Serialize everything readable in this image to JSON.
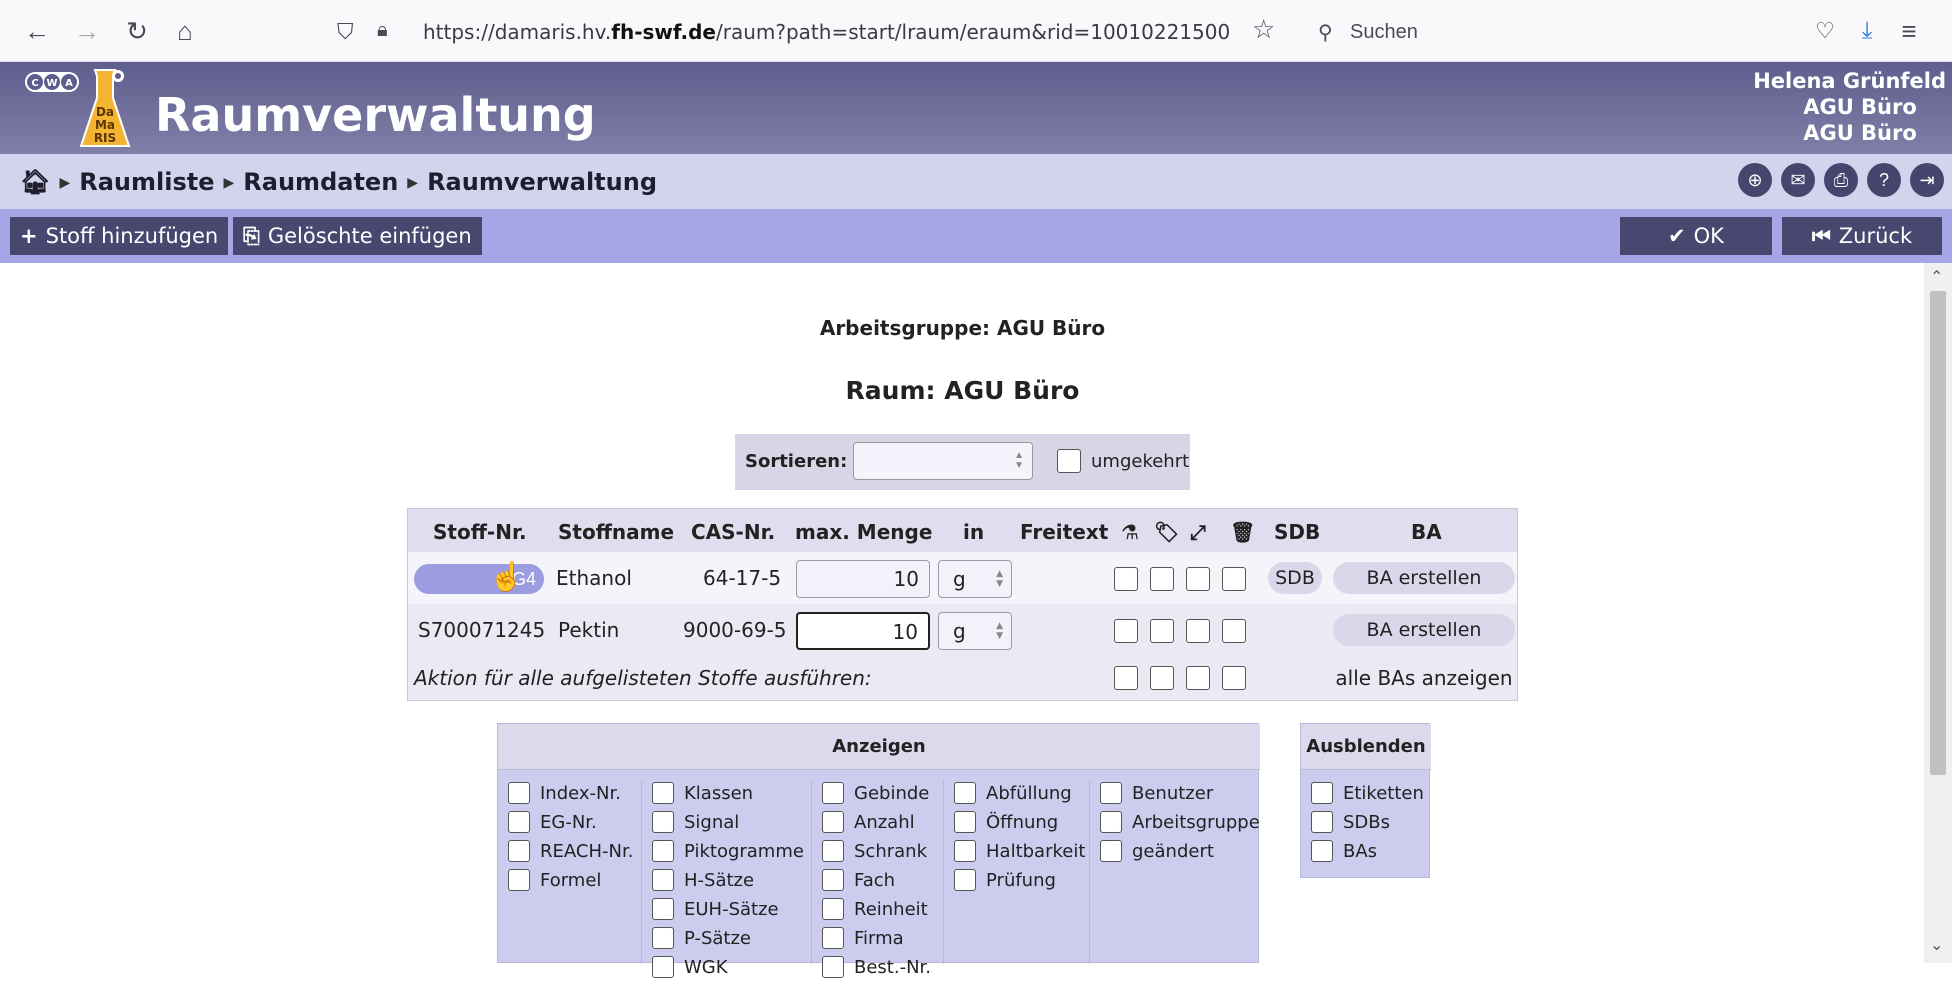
{
  "browser": {
    "url_prefix": "https://damaris.hv.",
    "url_domain": "fh-swf.de",
    "url_path": "/raum?path=start/lraum/eraum&rid=10010221500",
    "search_placeholder": "Suchen"
  },
  "header": {
    "app_title": "Raumverwaltung",
    "logo_cwa": "CWA",
    "logo_da": "Da",
    "logo_ma": "Ma",
    "logo_ris": "RIS",
    "user_name": "Helena Grünfeld",
    "user_group": "AGU Büro",
    "user_room": "AGU Büro"
  },
  "breadcrumb": [
    "Raumliste",
    "Raumdaten",
    "Raumverwaltung"
  ],
  "toolbar": {
    "add_substance": "Stoff hinzufügen",
    "insert_deleted": "Gelöschte einfügen",
    "ok": "OK",
    "back": "Zurück"
  },
  "page": {
    "group_title": "Arbeitsgruppe: AGU Büro",
    "room_title": "Raum: AGU Büro"
  },
  "sort": {
    "label": "Sortieren:",
    "selected": "",
    "reverse_label": "umgekehrt"
  },
  "table": {
    "headers": {
      "stoff_nr": "Stoff-Nr.",
      "stoffname": "Stoffname",
      "cas": "CAS-Nr.",
      "max_menge": "max. Menge",
      "in": "in",
      "freitext": "Freitext",
      "sdb": "SDB",
      "ba": "BA"
    },
    "rows": [
      {
        "stoff_nr": "KG4",
        "name": "Ethanol",
        "cas": "64-17-5",
        "qty": "10",
        "unit": "g",
        "sdb": "SDB",
        "ba": "BA erstellen"
      },
      {
        "stoff_nr": "S700071245",
        "name": "Pektin",
        "cas": "9000-69-5",
        "qty": "10",
        "unit": "g",
        "sdb": "",
        "ba": "BA erstellen"
      }
    ],
    "action_text": "Aktion für alle aufgelisteten Stoffe ausführen:",
    "all_bas": "alle BAs anzeigen"
  },
  "anzeigen": {
    "title": "Anzeigen",
    "col1": [
      "Index-Nr.",
      "EG-Nr.",
      "REACH-Nr.",
      "Formel"
    ],
    "col2": [
      "Klassen",
      "Signal",
      "Piktogramme",
      "H-Sätze",
      "EUH-Sätze",
      "P-Sätze",
      "WGK"
    ],
    "col3": [
      "Gebinde",
      "Anzahl",
      "Schrank",
      "Fach",
      "Reinheit",
      "Firma",
      "Best.-Nr."
    ],
    "col4": [
      "Abfüllung",
      "Öffnung",
      "Haltbarkeit",
      "Prüfung"
    ],
    "col5": [
      "Benutzer",
      "Arbeitsgruppe",
      "geändert"
    ]
  },
  "ausblenden": {
    "title": "Ausblenden",
    "items": [
      "Etiketten",
      "SDBs",
      "BAs"
    ]
  },
  "colors": {
    "header_bg": "#6f6e9a",
    "crumb_bg": "#d3d3ee",
    "toolbar_bg": "#a6a6e6",
    "button_dark": "#474770",
    "pill": "#9c9ce0"
  }
}
